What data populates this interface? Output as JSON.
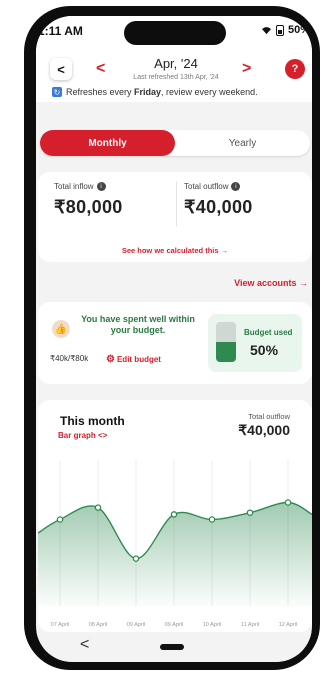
{
  "status_bar": {
    "time": "1:11 AM",
    "battery": "50%"
  },
  "header": {
    "back_icon": "<",
    "prev_icon": "<",
    "next_icon": ">",
    "month": "Apr, '24",
    "last_refreshed": "Last refreshed 13th Apr, '24",
    "help_icon": "?",
    "refresh_note_prefix": "Refreshes every ",
    "refresh_note_day": "Friday",
    "refresh_note_suffix": ", review every weekend."
  },
  "tabs": [
    {
      "label": "Monthly",
      "active": true
    },
    {
      "label": "Yearly",
      "active": false
    }
  ],
  "flow": {
    "inflow_label": "Total inflow",
    "inflow_value": "₹80,000",
    "outflow_label": "Total outflow",
    "outflow_value": "₹40,000",
    "calc_link": "See how we calculated this →"
  },
  "view_accounts": "View accounts →",
  "budget": {
    "message": "You have spent well within your budget.",
    "amount": "₹40k/₹80k",
    "edit_label": "Edit budget",
    "used_label": "Budget used",
    "used_percent": "50%",
    "used_fraction": 0.5
  },
  "chart_card": {
    "title": "This month",
    "subtitle": "Bar graph <>",
    "outflow_label": "Total outflow",
    "outflow_value": "₹40,000"
  },
  "chart_data": {
    "type": "area",
    "title": "This month",
    "categories": [
      "07 April",
      "08 April",
      "09 April",
      "09 April",
      "10 April",
      "11 April",
      "12 April"
    ],
    "values": [
      4500,
      5200,
      2200,
      4800,
      4500,
      4900,
      5500
    ],
    "ylim": [
      0,
      8000
    ],
    "grid": true,
    "color": "#2f8a52"
  },
  "colors": {
    "brand": "#d61f2c",
    "success": "#2f8a52"
  },
  "bottom_nav": {
    "back_icon": "<"
  }
}
